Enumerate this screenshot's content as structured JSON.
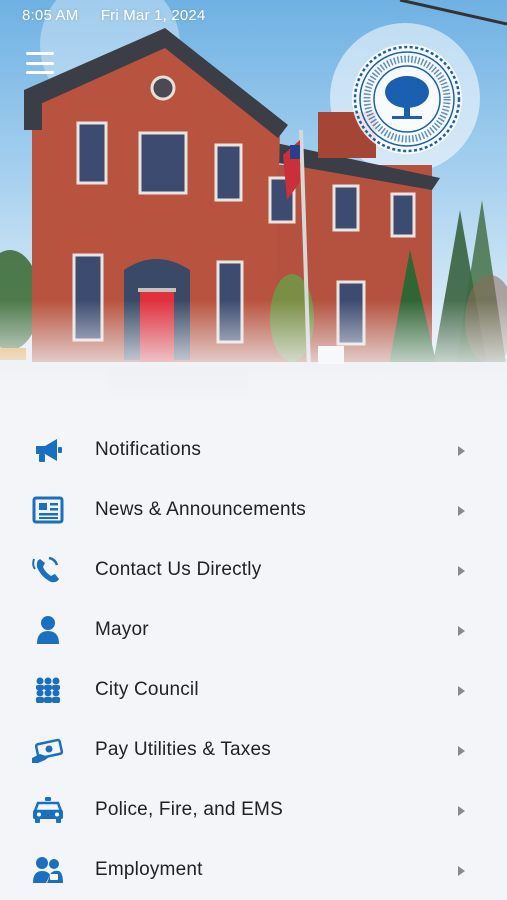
{
  "status_bar": {
    "time": "8:05 AM",
    "date": "Fri Mar 1, 2024"
  },
  "header": {
    "menu_icon": "hamburger-menu-icon",
    "seal_icon": "city-council-seal-icon"
  },
  "theme": {
    "accent": "#1a6fc0",
    "text": "#222222",
    "chevron": "#8a8a8a",
    "background": "#f3f5f8"
  },
  "menu": {
    "items": [
      {
        "label": "Notifications",
        "icon": "megaphone-icon"
      },
      {
        "label": "News & Announcements",
        "icon": "newspaper-icon"
      },
      {
        "label": "Contact Us Directly",
        "icon": "phone-icon"
      },
      {
        "label": "Mayor",
        "icon": "person-icon"
      },
      {
        "label": "City Council",
        "icon": "group-icon"
      },
      {
        "label": "Pay Utilities & Taxes",
        "icon": "money-hand-icon"
      },
      {
        "label": "Police, Fire, and EMS",
        "icon": "police-car-icon"
      },
      {
        "label": "Employment",
        "icon": "employment-icon"
      }
    ]
  }
}
